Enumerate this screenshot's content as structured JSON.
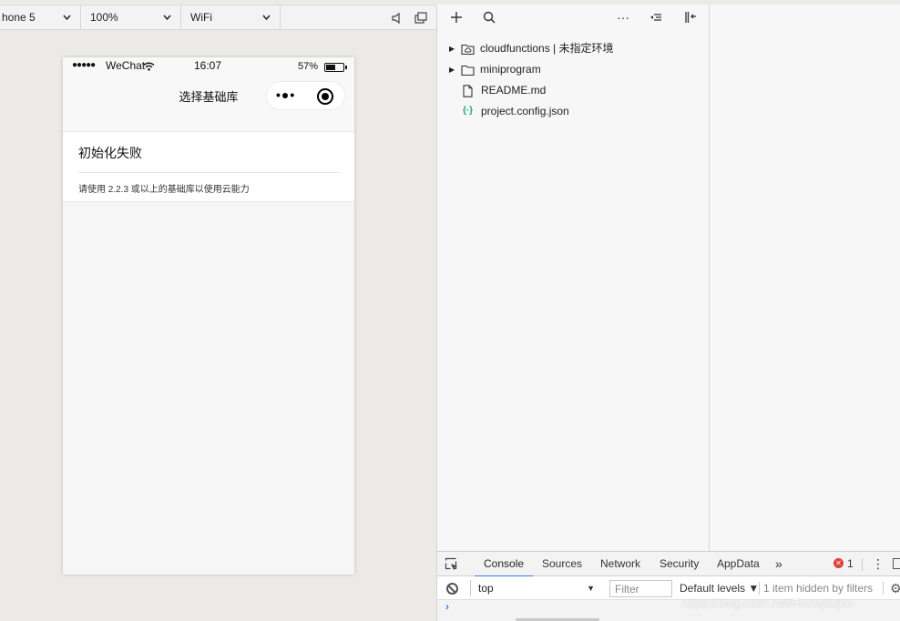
{
  "simulator": {
    "device_label": "hone 5",
    "zoom_label": "100%",
    "network_label": "WiFi",
    "status_bar": {
      "signal": "●●●●●",
      "carrier": "WeChat",
      "time": "16:07",
      "battery_pct": "57%",
      "battery_level": 0.57
    },
    "nav_title": "选择基础库",
    "capsule_more": "•●•",
    "card": {
      "title": "初始化失败",
      "desc": "请使用 2.2.3 或以上的基础库以使用云能力"
    }
  },
  "file_tree": {
    "items": [
      {
        "name": "cloudfunctions | 未指定环境",
        "type": "cloud-folder",
        "expandable": true
      },
      {
        "name": "miniprogram",
        "type": "folder",
        "expandable": true
      },
      {
        "name": "README.md",
        "type": "file",
        "expandable": false
      },
      {
        "name": "project.config.json",
        "type": "json",
        "expandable": false
      }
    ],
    "toolbar_more": "···"
  },
  "devtools": {
    "tabs": [
      "Console",
      "Sources",
      "Network",
      "Security",
      "AppData"
    ],
    "active_tab": "Console",
    "overflow": "»",
    "error_count": "1",
    "context": "top",
    "filter_placeholder": "Filter",
    "levels": "Default levels ▼",
    "hidden_info": "1 item hidden by filters",
    "prompt": "›"
  },
  "watermark": "https://blog.csdn.net/Fionapiupiu",
  "colors": {
    "accent": "#3b7ee6",
    "error": "#e0413a",
    "json_icon": "#17a37a"
  }
}
